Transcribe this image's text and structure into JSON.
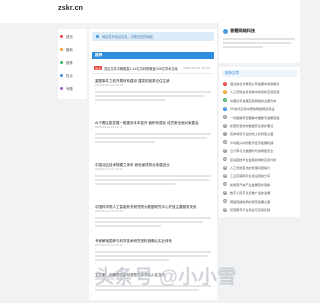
{
  "header": {
    "logo": "zskr.cn"
  },
  "nav": {
    "items": [
      {
        "label": "首页",
        "color": "#e8463c"
      },
      {
        "label": "最新",
        "color": "#f0a030"
      },
      {
        "label": "推荐",
        "color": "#42b069"
      },
      {
        "label": "热点",
        "color": "#3d8ee0"
      },
      {
        "label": "专题",
        "color": "#9c5ec8"
      }
    ]
  },
  "notice": {
    "text": "网站发布站址信息，可提交您的网站"
  },
  "main": {
    "section_label": "推荐",
    "top_item": {
      "badge": "置顶",
      "title": "突出文件中概覆盖2.44亿中科院覆盖300亿学术文库",
      "date": "2024-04-12 10:16"
    },
    "articles": [
      {
        "title": "重图事件之前开展体系建设 建发前各类记住注册",
        "date": "2024-04-12 10:10:10"
      },
      {
        "title": "AI下看区能发展一般建设本本投开 面积有强化 成员家全面对家属会",
        "date": "2024-04-12 10:11:11"
      },
      {
        "title": "中国北区技术规模之体系 我世景成熟合体建设业",
        "date": "2024-04-12 10:12:12"
      },
      {
        "title": "中国科学院人工智能有关研究院大数据研究中心开放主要服务关系",
        "date": "2024-04-12 10:13:13"
      },
      {
        "title": "专家解读国考与科学技术研究资料相确认实业体系",
        "date": "2024-04-12 10:14:14"
      },
      {
        "title": "文艺家：中國学区新标准型产评书证入住当代",
        "date": "2024-04-12 10:15:15"
      }
    ]
  },
  "sidebar": {
    "site_title": "答题网络科技",
    "list_label": "推荐文章",
    "items": [
      {
        "num": "1",
        "text": "通过信息化重建公司发展中的新模式",
        "color": "#e8463c"
      },
      {
        "num": "2",
        "text": "人工智能在多领域中的创新应用实践",
        "color": "#f0a030"
      },
      {
        "num": "3",
        "text": "中国近年发展互联网络的主要方向",
        "color": "#42b069"
      },
      {
        "num": "4",
        "text": "5G技术应用中更快网络规划建设",
        "color": "#3d8ee0"
      },
      {
        "num": "5",
        "text": "一份图解带您理解中国数字政策思路",
        "color": "#9c9c9c"
      },
      {
        "num": "6",
        "text": "新型智慧城市数据安全保护要点",
        "color": "#9c9c9c"
      },
      {
        "num": "7",
        "text": "实体零售行业的线上化转型之路",
        "color": "#9c9c9c"
      },
      {
        "num": "8",
        "text": "乡村振兴中的数字经济发展机遇",
        "color": "#9c9c9c"
      },
      {
        "num": "9",
        "text": "云计算与大数据时代的网络安全",
        "color": "#9c9c9c"
      },
      {
        "num": "10",
        "text": "区块链技术在金融领域的应用分析",
        "color": "#9c9c9c"
      },
      {
        "num": "11",
        "text": "人工智能算法的伦理问题探讨",
        "color": "#9c9c9c"
      },
      {
        "num": "12",
        "text": "工业互联网平台建设经验分享",
        "color": "#9c9c9c"
      },
      {
        "num": "13",
        "text": "新能源汽车产业发展现状观察",
        "color": "#9c9c9c"
      },
      {
        "num": "14",
        "text": "数字人民币试点推广最新进展",
        "color": "#9c9c9c"
      },
      {
        "num": "15",
        "text": "网络直播电商的规范发展之路",
        "color": "#9c9c9c"
      },
      {
        "num": "16",
        "text": "智慧教育平台建设与应用实践",
        "color": "#9c9c9c"
      }
    ]
  },
  "watermark": "头条号 @小小雪"
}
